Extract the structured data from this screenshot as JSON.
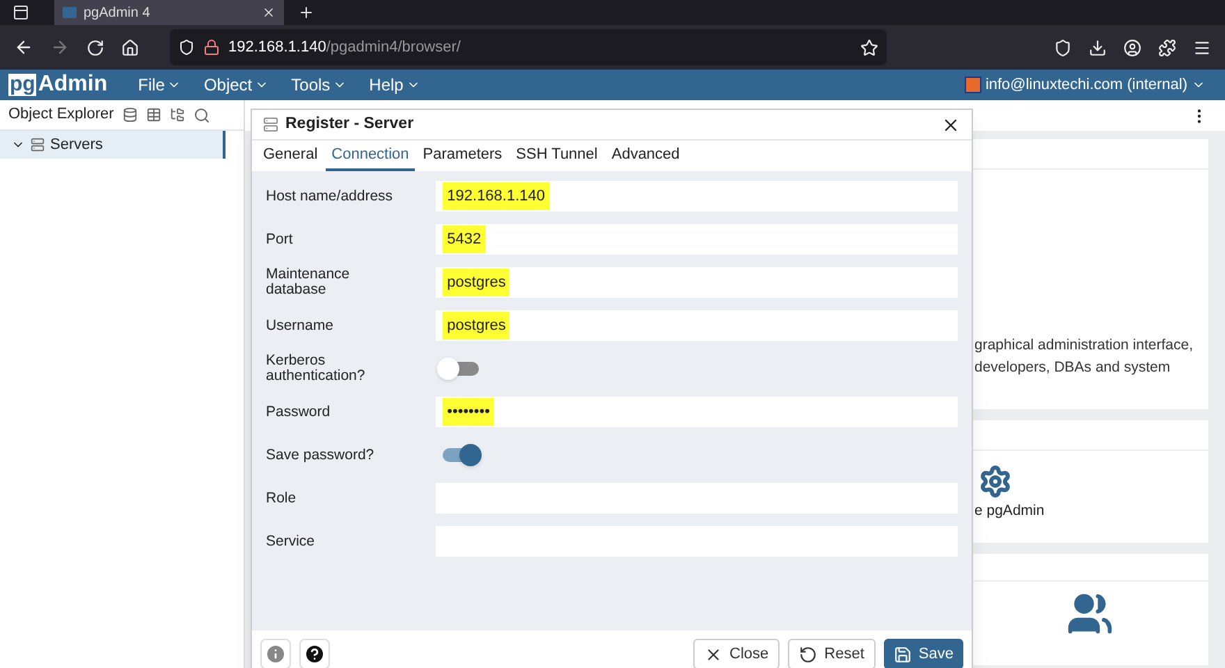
{
  "browser": {
    "tab_title": "pgAdmin 4",
    "url_host": "192.168.1.140",
    "url_path": "/pgadmin4/browser/"
  },
  "app_bar": {
    "logo_box": "pg",
    "logo_text": "Admin",
    "menus": [
      "File",
      "Object",
      "Tools",
      "Help"
    ],
    "user": "info@linuxtechi.com (internal)"
  },
  "object_explorer": {
    "title": "Object Explorer",
    "tree": [
      {
        "label": "Servers",
        "expanded": true,
        "selected": true
      }
    ]
  },
  "dashboard": {
    "welcome_lines": [
      "graphical administration interface,",
      "developers, DBAs and system"
    ],
    "configure_label": "e pgAdmin"
  },
  "dialog": {
    "title": "Register - Server",
    "tabs": [
      {
        "label": "General",
        "selected": false
      },
      {
        "label": "Connection",
        "selected": true
      },
      {
        "label": "Parameters",
        "selected": false
      },
      {
        "label": "SSH Tunnel",
        "selected": false
      },
      {
        "label": "Advanced",
        "selected": false
      }
    ],
    "fields": [
      {
        "kind": "text",
        "label": "Host name/address",
        "value": "192.168.1.140",
        "highlighted": true
      },
      {
        "kind": "text",
        "label": "Port",
        "value": "5432",
        "highlighted": true
      },
      {
        "kind": "text",
        "label": "Maintenance database",
        "value": "postgres",
        "highlighted": true
      },
      {
        "kind": "text",
        "label": "Username",
        "value": "postgres",
        "highlighted": true
      },
      {
        "kind": "toggle",
        "label": "Kerberos authentication?",
        "on": false
      },
      {
        "kind": "text",
        "label": "Password",
        "value": "••••••••",
        "highlighted": true
      },
      {
        "kind": "toggle",
        "label": "Save password?",
        "on": true
      },
      {
        "kind": "text",
        "label": "Role"
      },
      {
        "kind": "text",
        "label": "Service"
      }
    ],
    "buttons": [
      {
        "kind": "close",
        "label": "Close"
      },
      {
        "kind": "reset",
        "label": "Reset"
      },
      {
        "kind": "save",
        "label": "Save"
      }
    ]
  }
}
